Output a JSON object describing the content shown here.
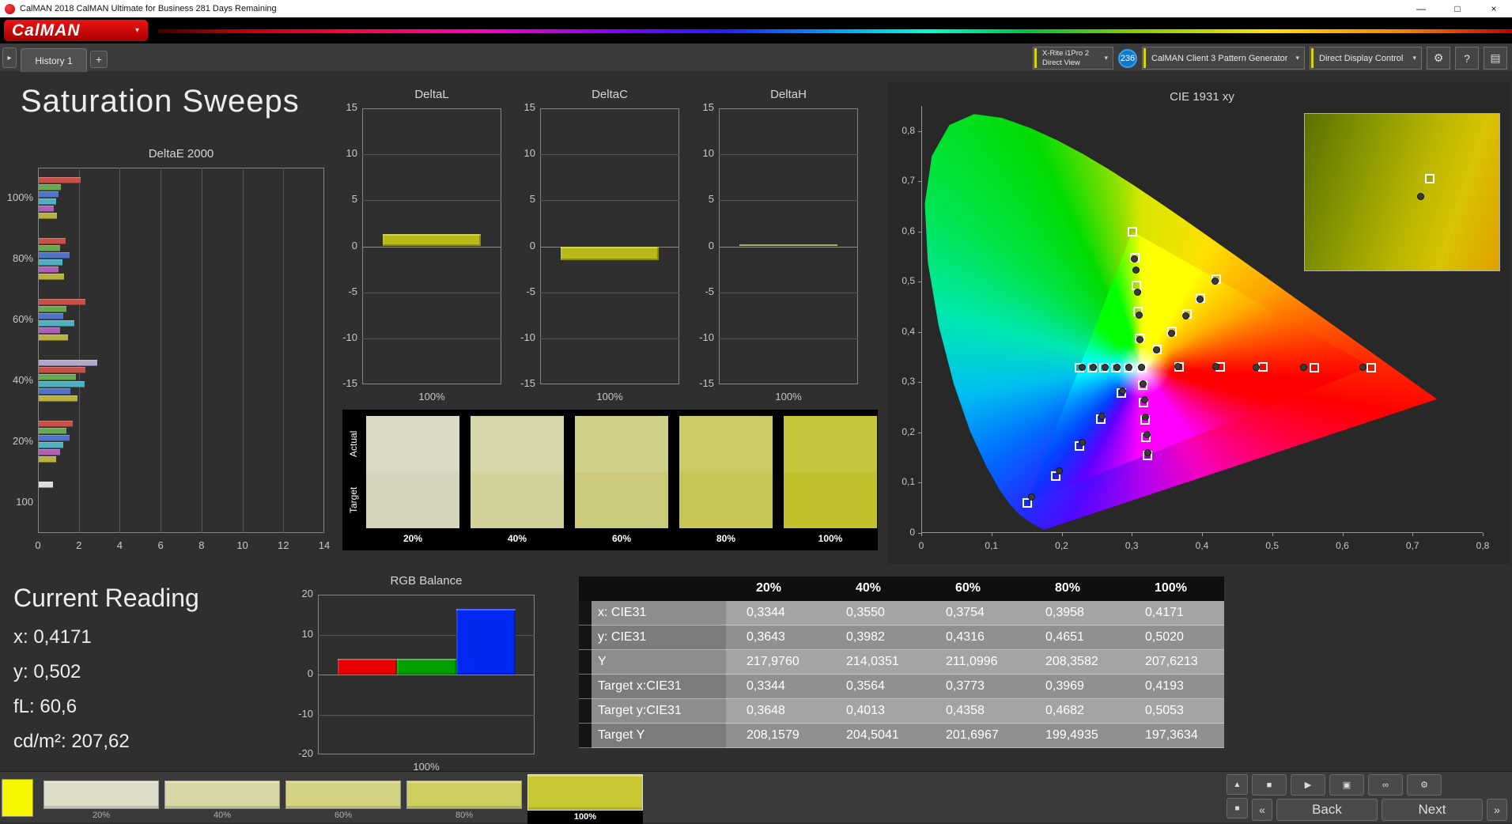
{
  "titlebar": {
    "title": "CalMAN 2018 CalMAN Ultimate for Business 281 Days Remaining",
    "minimize": "—",
    "maximize": "□",
    "close": "×"
  },
  "logo": {
    "text": "CalMAN"
  },
  "icons": {
    "caret": "▾",
    "gear": "⚙",
    "help": "?",
    "panel": "▤",
    "tab_nav": "▸",
    "stop": "■",
    "play": "▶",
    "capture": "▣",
    "loop": "∞",
    "up": "▲",
    "patch": "■",
    "prev": "«",
    "fwd": "»"
  },
  "toolbar": {
    "history_tab": "History 1",
    "add_tab": "+",
    "meter_device": {
      "line1": "X-Rite i1Pro 2",
      "line2": "Direct View"
    },
    "meter_count": "236",
    "pattern_generator": "CalMAN Client 3 Pattern Generator",
    "display_control": "Direct Display Control"
  },
  "page_title": "Saturation Sweeps",
  "current_reading": {
    "title": "Current Reading",
    "lines": [
      {
        "label": "x:",
        "value": "0,4171"
      },
      {
        "label": "y:",
        "value": "0,502"
      },
      {
        "label": "fL:",
        "value": "60,6"
      },
      {
        "label": "cd/m²:",
        "value": "207,62"
      }
    ]
  },
  "results_table": {
    "columns": [
      "20%",
      "40%",
      "60%",
      "80%",
      "100%"
    ],
    "rows": [
      {
        "label": "x: CIE31",
        "values": [
          "0,3344",
          "0,3550",
          "0,3754",
          "0,3958",
          "0,4171"
        ]
      },
      {
        "label": "y: CIE31",
        "values": [
          "0,3643",
          "0,3982",
          "0,4316",
          "0,4651",
          "0,5020"
        ]
      },
      {
        "label": "Y",
        "values": [
          "217,9760",
          "214,0351",
          "211,0996",
          "208,3582",
          "207,6213"
        ]
      },
      {
        "label": "Target x:CIE31",
        "values": [
          "0,3344",
          "0,3564",
          "0,3773",
          "0,3969",
          "0,4193"
        ]
      },
      {
        "label": "Target y:CIE31",
        "values": [
          "0,3648",
          "0,4013",
          "0,4358",
          "0,4682",
          "0,5053"
        ]
      },
      {
        "label": "Target Y",
        "values": [
          "208,1579",
          "204,5041",
          "201,6967",
          "199,4935",
          "197,3634"
        ]
      }
    ]
  },
  "patch_bar": {
    "current_patch_color": "#f6f600",
    "swatches": [
      {
        "label": "20%",
        "color": "#dcdcc8",
        "selected": false
      },
      {
        "label": "40%",
        "color": "#d8d8a4",
        "selected": false
      },
      {
        "label": "60%",
        "color": "#d2d282",
        "selected": false
      },
      {
        "label": "80%",
        "color": "#cece5e",
        "selected": false
      },
      {
        "label": "100%",
        "color": "#c8c832",
        "selected": true
      }
    ],
    "back": "Back",
    "next": "Next"
  },
  "chart_data": [
    {
      "id": "deltaE",
      "type": "bar",
      "orientation": "horizontal",
      "title": "DeltaE 2000",
      "xlim": [
        0,
        14
      ],
      "xticks": [
        0,
        2,
        4,
        6,
        8,
        10,
        12,
        14
      ],
      "groups": [
        {
          "label": "100%",
          "bars": [
            {
              "color": "#c85048",
              "value": 2.05
            },
            {
              "color": "#6aa84f",
              "value": 1.1
            },
            {
              "color": "#4f74c8",
              "value": 0.95
            },
            {
              "color": "#4fb0c0",
              "value": 0.85
            },
            {
              "color": "#b05fb8",
              "value": 0.75
            },
            {
              "color": "#b8b040",
              "value": 0.9
            }
          ]
        },
        {
          "label": "80%",
          "bars": [
            {
              "color": "#c85048",
              "value": 1.3
            },
            {
              "color": "#6aa84f",
              "value": 1.05
            },
            {
              "color": "#4f74c8",
              "value": 1.5
            },
            {
              "color": "#4fb0c0",
              "value": 1.15
            },
            {
              "color": "#b05fb8",
              "value": 0.95
            },
            {
              "color": "#b8b040",
              "value": 1.25
            }
          ]
        },
        {
          "label": "60%",
          "bars": [
            {
              "color": "#c85048",
              "value": 2.3
            },
            {
              "color": "#6aa84f",
              "value": 1.35
            },
            {
              "color": "#4f74c8",
              "value": 1.2
            },
            {
              "color": "#4fb0c0",
              "value": 1.75
            },
            {
              "color": "#b05fb8",
              "value": 1.05
            },
            {
              "color": "#b8b040",
              "value": 1.45
            }
          ]
        },
        {
          "label": "40%",
          "bars": [
            {
              "color": "#b0a8c8",
              "value": 2.85
            },
            {
              "color": "#c85048",
              "value": 2.3
            },
            {
              "color": "#6aa84f",
              "value": 1.8
            },
            {
              "color": "#4fb0c0",
              "value": 2.25
            },
            {
              "color": "#4f74c8",
              "value": 1.55
            },
            {
              "color": "#b8b040",
              "value": 1.9
            }
          ]
        },
        {
          "label": "20%",
          "bars": [
            {
              "color": "#c85048",
              "value": 1.65
            },
            {
              "color": "#6aa84f",
              "value": 1.35
            },
            {
              "color": "#4f74c8",
              "value": 1.5
            },
            {
              "color": "#4fb0c0",
              "value": 1.2
            },
            {
              "color": "#b05fb8",
              "value": 1.05
            },
            {
              "color": "#b8b040",
              "value": 0.85
            }
          ]
        },
        {
          "label": "100",
          "bars": [
            {
              "color": "#dcdcdc",
              "value": 0.7
            }
          ]
        }
      ]
    },
    {
      "id": "deltaL",
      "type": "bar",
      "title": "DeltaL",
      "ylim": [
        -15,
        15
      ],
      "yticks": [
        15,
        10,
        5,
        0,
        -5,
        -10,
        -15
      ],
      "categories": [
        "100%"
      ],
      "values": [
        1.3
      ],
      "bar_color": "#b8ba18"
    },
    {
      "id": "deltaC",
      "type": "bar",
      "title": "DeltaC",
      "ylim": [
        -15,
        15
      ],
      "yticks": [
        15,
        10,
        5,
        0,
        -5,
        -10,
        -15
      ],
      "categories": [
        "100%"
      ],
      "values": [
        -1.5
      ],
      "bar_color": "#b8ba18"
    },
    {
      "id": "deltaH",
      "type": "bar",
      "title": "DeltaH",
      "ylim": [
        -15,
        15
      ],
      "yticks": [
        15,
        10,
        5,
        0,
        -5,
        -10,
        -15
      ],
      "categories": [
        "100%"
      ],
      "values": [
        0.2
      ],
      "bar_color": "#b8ba18"
    },
    {
      "id": "rgb",
      "type": "bar",
      "title": "RGB Balance",
      "ylim": [
        -20,
        20
      ],
      "yticks": [
        20,
        10,
        0,
        -10,
        -20
      ],
      "categories": [
        "100%"
      ],
      "series": [
        {
          "name": "Red",
          "color": "#e80000",
          "value": 4.0
        },
        {
          "name": "Green",
          "color": "#00a000",
          "value": 4.0
        },
        {
          "name": "Blue",
          "color": "#0028f0",
          "value": 16.5
        }
      ]
    },
    {
      "id": "swatches",
      "type": "table",
      "title": "Actual vs Target swatches",
      "row_labels": [
        "Actual",
        "Target"
      ],
      "columns": [
        "20%",
        "40%",
        "60%",
        "80%",
        "100%"
      ],
      "actual_colors": [
        "#d9d9c5",
        "#d6d6a6",
        "#d0d089",
        "#cbcb66",
        "#c6c63d"
      ],
      "target_colors": [
        "#d5d5bb",
        "#d2d29a",
        "#cbcb79",
        "#c7c754",
        "#c1c12c"
      ]
    },
    {
      "id": "cie",
      "type": "scatter",
      "title": "CIE 1931 xy",
      "xlim": [
        0,
        0.8
      ],
      "ylim": [
        0,
        0.85
      ],
      "xticks": [
        "0",
        "0,1",
        "0,2",
        "0,3",
        "0,4",
        "0,5",
        "0,6",
        "0,7",
        "0,8"
      ],
      "yticks": [
        "0",
        "0,1",
        "0,2",
        "0,3",
        "0,4",
        "0,5",
        "0,6",
        "0,7",
        "0,8"
      ],
      "series": [
        {
          "name": "white-target",
          "marker": "square",
          "points": [
            [
              0.3127,
              0.329
            ]
          ]
        },
        {
          "name": "red-target",
          "marker": "square",
          "points": [
            [
              0.3658,
              0.331
            ],
            [
              0.4249,
              0.3304
            ],
            [
              0.4861,
              0.3299
            ],
            [
              0.5592,
              0.3294
            ],
            [
              0.64,
              0.329
            ]
          ]
        },
        {
          "name": "green-target",
          "marker": "square",
          "points": [
            [
              0.3095,
              0.3878
            ],
            [
              0.3077,
              0.441
            ],
            [
              0.3058,
              0.4926
            ],
            [
              0.3031,
              0.5471
            ],
            [
              0.3,
              0.6
            ]
          ]
        },
        {
          "name": "blue-target",
          "marker": "square",
          "points": [
            [
              0.2841,
              0.2786
            ],
            [
              0.2545,
              0.2262
            ],
            [
              0.2246,
              0.1731
            ],
            [
              0.1906,
              0.1128
            ],
            [
              0.15,
              0.06
            ]
          ]
        },
        {
          "name": "cyan-target",
          "marker": "square",
          "points": [
            [
              0.2942,
              0.3289
            ],
            [
              0.2766,
              0.3288
            ],
            [
              0.2589,
              0.3288
            ],
            [
              0.2418,
              0.3287
            ],
            [
              0.2246,
              0.3287
            ]
          ]
        },
        {
          "name": "magenta-target",
          "marker": "square",
          "points": [
            [
              0.3143,
              0.2947
            ],
            [
              0.316,
              0.26
            ],
            [
              0.3177,
              0.2254
            ],
            [
              0.3194,
              0.19
            ],
            [
              0.321,
              0.1542
            ]
          ]
        },
        {
          "name": "yellow-target",
          "marker": "square",
          "points": [
            [
              0.3344,
              0.3648
            ],
            [
              0.3564,
              0.4013
            ],
            [
              0.3773,
              0.4358
            ],
            [
              0.3969,
              0.4682
            ],
            [
              0.4193,
              0.5053
            ]
          ]
        },
        {
          "name": "white-measured",
          "marker": "circle",
          "points": [
            [
              0.3127,
              0.3292
            ]
          ]
        },
        {
          "name": "red-measured",
          "marker": "circle",
          "points": [
            [
              0.3642,
              0.3312
            ],
            [
              0.419,
              0.3308
            ],
            [
              0.4762,
              0.3303
            ],
            [
              0.544,
              0.3298
            ],
            [
              0.628,
              0.3293
            ]
          ]
        },
        {
          "name": "green-measured",
          "marker": "circle",
          "points": [
            [
              0.3102,
              0.3845
            ],
            [
              0.3088,
              0.433
            ],
            [
              0.3072,
              0.479
            ],
            [
              0.305,
              0.523
            ],
            [
              0.3028,
              0.545
            ]
          ]
        },
        {
          "name": "blue-measured",
          "marker": "circle",
          "points": [
            [
              0.2852,
              0.282
            ],
            [
              0.2568,
              0.2318
            ],
            [
              0.2282,
              0.1805
            ],
            [
              0.195,
              0.123
            ],
            [
              0.1562,
              0.071
            ]
          ]
        },
        {
          "name": "cyan-measured",
          "marker": "circle",
          "points": [
            [
              0.295,
              0.3296
            ],
            [
              0.278,
              0.3296
            ],
            [
              0.261,
              0.3297
            ],
            [
              0.2445,
              0.3297
            ],
            [
              0.228,
              0.3298
            ]
          ]
        },
        {
          "name": "magenta-measured",
          "marker": "circle",
          "points": [
            [
              0.315,
              0.2975
            ],
            [
              0.3168,
              0.2645
            ],
            [
              0.3186,
              0.231
            ],
            [
              0.3202,
              0.1962
            ],
            [
              0.3218,
              0.16
            ]
          ]
        },
        {
          "name": "yellow-measured",
          "marker": "circle",
          "points": [
            [
              0.3344,
              0.3643
            ],
            [
              0.355,
              0.3982
            ],
            [
              0.3754,
              0.4316
            ],
            [
              0.3958,
              0.4651
            ],
            [
              0.4171,
              0.502
            ]
          ]
        }
      ]
    }
  ]
}
